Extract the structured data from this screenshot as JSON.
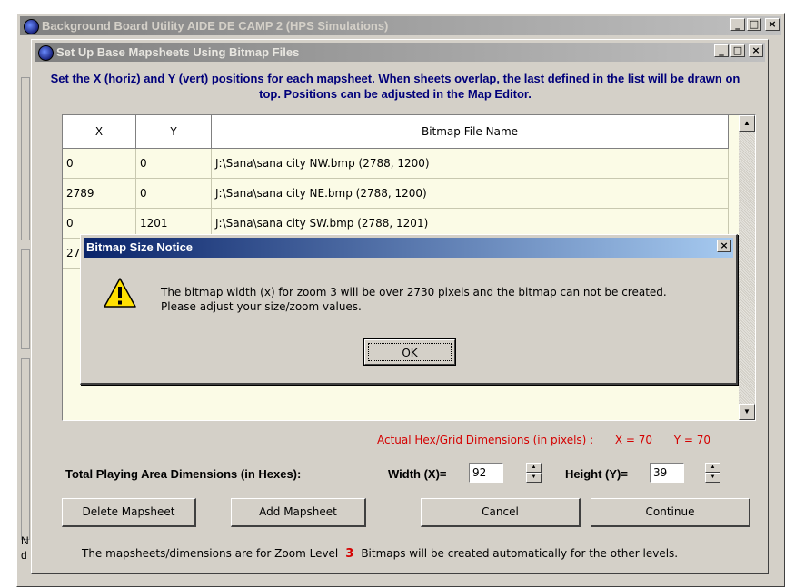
{
  "outer_window": {
    "title": "Background Board Utility  AIDE DE CAMP 2  (HPS Simulations)",
    "min_label": "_",
    "max_label": "□",
    "close_label": "×",
    "left_edge_text_1": "N",
    "left_edge_text_2": "d"
  },
  "dialog": {
    "title": "Set Up Base Mapsheets Using Bitmap Files",
    "min_label": "_",
    "max_label": "□",
    "close_label": "×",
    "instructions": "Set the X (horiz) and Y (vert) positions for each mapsheet.  When sheets overlap, the last defined in the list will be drawn on top.  Positions can be adjusted in the Map Editor.",
    "grid": {
      "columns": [
        "X",
        "Y",
        "Bitmap File Name"
      ],
      "rows": [
        {
          "x": "0",
          "y": "0",
          "file": "J:\\Sana\\sana city NW.bmp  (2788, 1200)"
        },
        {
          "x": "2789",
          "y": "0",
          "file": "J:\\Sana\\sana city NE.bmp  (2788, 1200)"
        },
        {
          "x": "0",
          "y": "1201",
          "file": "J:\\Sana\\sana city SW.bmp  (2788, 1201)"
        },
        {
          "x": "27",
          "y": "",
          "file": ""
        }
      ]
    },
    "hex_dims": {
      "label": "Actual Hex/Grid Dimensions (in pixels) :",
      "x_text": "X = 70",
      "y_text": "Y = 70"
    },
    "total_label": "Total Playing Area Dimensions (in Hexes):",
    "width_label": "Width (X)=",
    "width_value": "92",
    "height_label": "Height (Y)=",
    "height_value": "39",
    "buttons": {
      "delete": "Delete Mapsheet",
      "add": "Add Mapsheet",
      "cancel": "Cancel",
      "continue": "Continue"
    },
    "footer": {
      "text_before": "The mapsheets/dimensions are for Zoom Level",
      "zoom": "3",
      "text_after": "Bitmaps will be created automatically for the other levels."
    }
  },
  "notice": {
    "title": "Bitmap Size Notice",
    "close_label": "×",
    "line1": "The bitmap width (x) for zoom 3 will be over 2730 pixels and the bitmap can not be created.",
    "line2": "Please adjust your size/zoom values.",
    "ok": "OK",
    "icon": "warning-icon"
  }
}
